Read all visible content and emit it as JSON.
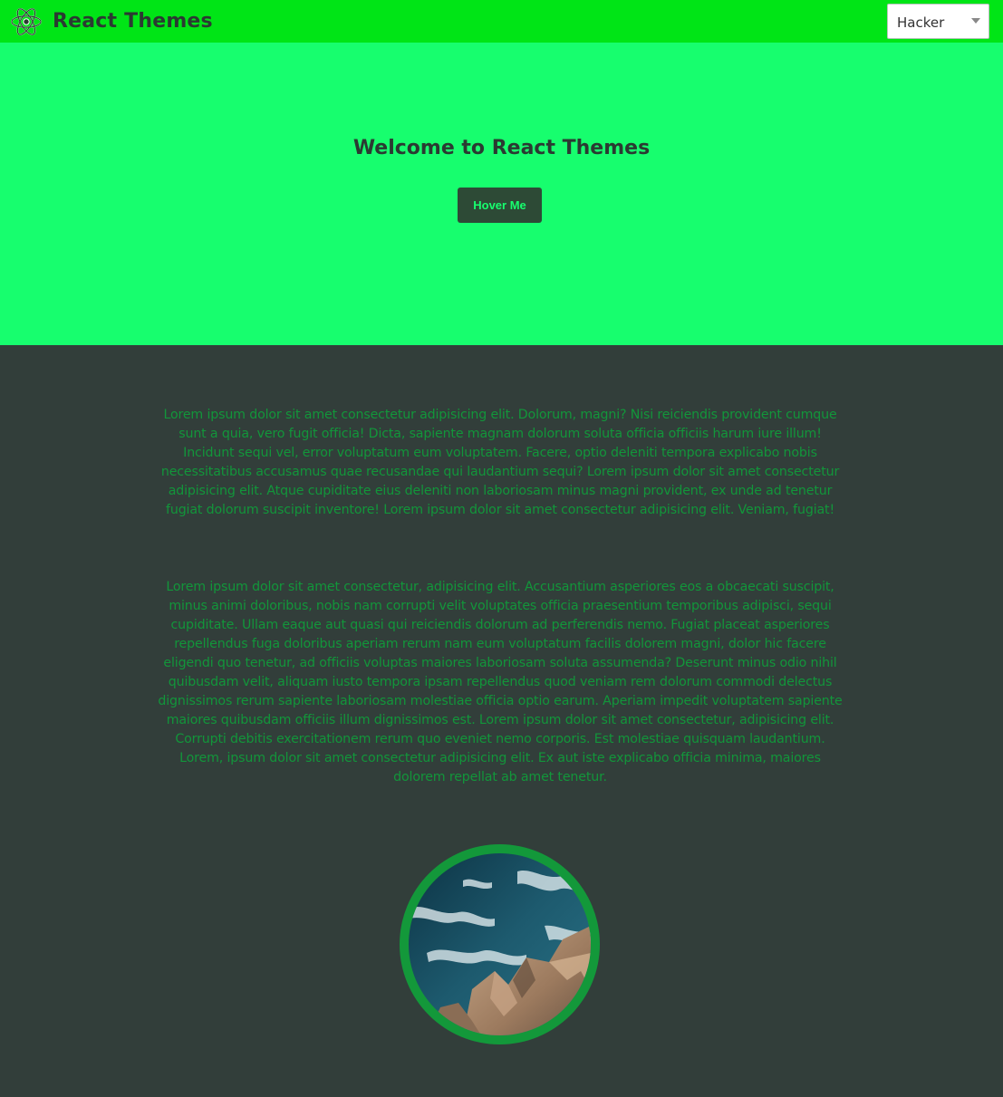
{
  "navbar": {
    "brand": "React Themes",
    "logo_icon": "react-atom-icon",
    "theme_select": {
      "value": "Hacker"
    }
  },
  "hero": {
    "title": "Welcome to React Themes",
    "button_label": "Hover Me"
  },
  "content": {
    "paragraph_1": "Lorem ipsum dolor sit amet consectetur adipisicing elit. Dolorum, magni? Nisi reiciendis provident cumque sunt a quia, vero fugit officia! Dicta, sapiente magnam dolorum soluta officia officiis harum iure illum! Incidunt sequi vel, error voluptatum eum voluptatem. Facere, optio deleniti tempora explicabo nobis necessitatibus accusamus quae recusandae qui laudantium sequi? Lorem ipsum dolor sit amet consectetur adipisicing elit. Atque cupiditate eius deleniti non laboriosam minus magni provident, ex unde ad tenetur fugiat dolorum suscipit inventore! Lorem ipsum dolor sit amet consectetur adipisicing elit. Veniam, fugiat!",
    "paragraph_2": "Lorem ipsum dolor sit amet consectetur, adipisicing elit. Accusantium asperiores eos a obcaecati suscipit, minus animi doloribus, nobis nam corrupti velit voluptates officia praesentium temporibus adipisci, sequi cupiditate. Ullam eaque aut quasi qui reiciendis dolorum ad perferendis nemo. Fugiat placeat asperiores repellendus fuga doloribus aperiam rerum nam eum voluptatum facilis dolorem magni, dolor hic facere eligendi quo tenetur, ad officiis voluptas maiores laboriosam soluta assumenda? Deserunt minus odio nihil quibusdam velit, aliquam iusto tempora ipsam repellendus quod veniam rem dolorum commodi delectus dignissimos rerum sapiente laboriosam molestiae officia optio earum. Aperiam impedit voluptatem sapiente maiores quibusdam officiis illum dignissimos est. Lorem ipsum dolor sit amet consectetur, adipisicing elit. Corrupti debitis exercitationem rerum quo eveniet nemo corporis. Est molestiae quisquam laudantium. Lorem, ipsum dolor sit amet consectetur adipisicing elit. Ex aut iste explicabo officia minima, maiores dolorem repellat ab amet tenetur."
  },
  "image": {
    "icon": "coastal-rocks-photo"
  },
  "colors": {
    "navbar_bg": "#00e516",
    "hero_bg": "#17fe6e",
    "page_bg": "#323e3a",
    "text_green": "#12963a",
    "heading_text": "#2b3a32",
    "button_bg": "#2d4a36"
  }
}
